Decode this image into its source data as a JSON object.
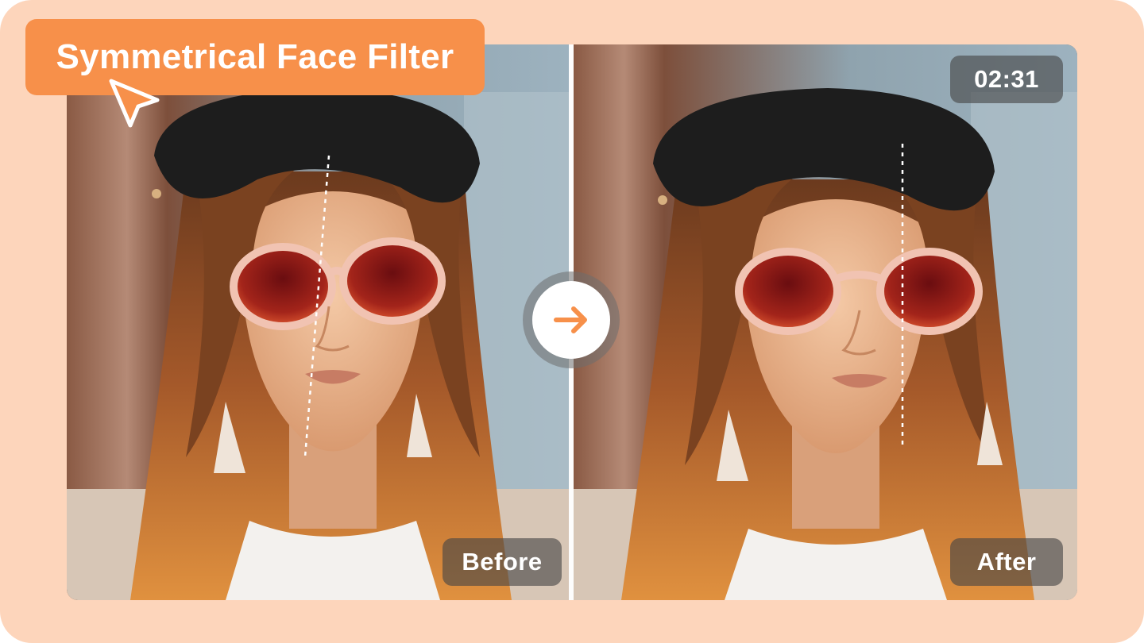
{
  "title": "Symmetrical Face Filter",
  "timer": "02:31",
  "labels": {
    "before": "Before",
    "after": "After"
  },
  "icons": {
    "cursor": "cursor-arrow-icon",
    "compare": "arrow-right-icon"
  },
  "colors": {
    "background": "#fdd5bb",
    "accent": "#f7904a",
    "label_bg": "#464646"
  }
}
